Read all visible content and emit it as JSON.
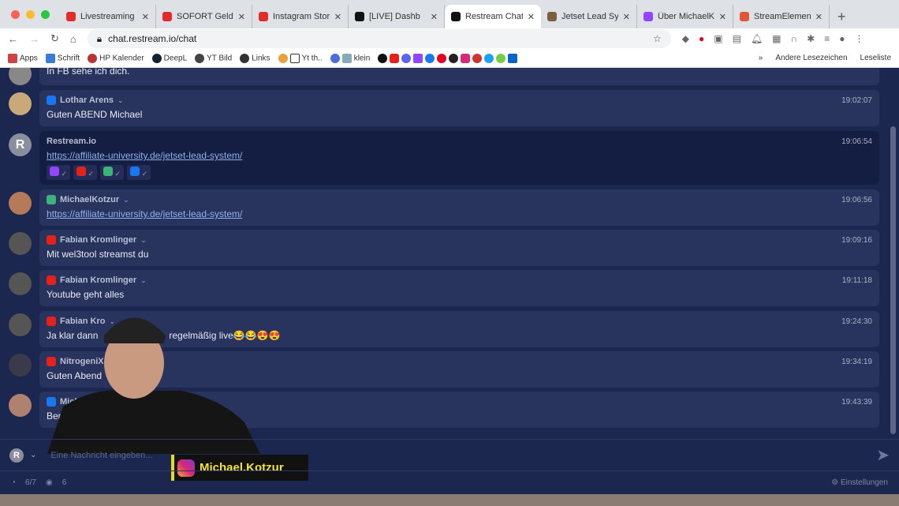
{
  "browser": {
    "tabs": [
      {
        "title": "Livestreaming",
        "color": "#e02c2c"
      },
      {
        "title": "SOFORT Geld",
        "color": "#e02c2c"
      },
      {
        "title": "Instagram Story",
        "color": "#e02c2c"
      },
      {
        "title": "[LIVE] Dashb",
        "color": "#111111"
      },
      {
        "title": "Restream Chat",
        "color": "#111111",
        "active": true
      },
      {
        "title": "Jetset Lead Sys",
        "color": "#7a6040"
      },
      {
        "title": "Über MichaelKo",
        "color": "#9146ff"
      },
      {
        "title": "StreamElement",
        "color": "#e0563a"
      }
    ],
    "url": "chat.restream.io/chat",
    "bookmarks": [
      "Apps",
      "Schrift",
      "HP Kalender",
      "DeepL",
      "YT Bild",
      "Links",
      "Yt th..",
      "klein"
    ],
    "bookmarks_right": [
      "Andere Lesezeichen",
      "Leseliste"
    ]
  },
  "messages": [
    {
      "author": "",
      "platform": "",
      "time": "",
      "text": "In FB sehe ich dich."
    },
    {
      "author": "Lothar Arens",
      "platform": "facebook",
      "time": "19:02:07",
      "text": "Guten ABEND Michael"
    },
    {
      "author": "Restream.io",
      "platform": "restream",
      "time": "19:06:54",
      "text": "https://affiliate-university.de/jetset-lead-system/"
    },
    {
      "author": "MichaelKotzur",
      "platform": "restream",
      "time": "19:06:56",
      "text": "https://affiliate-university.de/jetset-lead-system/"
    },
    {
      "author": "Fabian Kromlinger",
      "platform": "youtube",
      "time": "19:09:16",
      "text": "Mit wel3tool streamst du"
    },
    {
      "author": "Fabian Kromlinger",
      "platform": "youtube",
      "time": "19:11:18",
      "text": "Youtube geht alles"
    },
    {
      "author": "Fabian Kro",
      "platform": "youtube",
      "time": "19:24:30",
      "text": "Ja klar dann",
      "text2": "regelmäßig live😂😂😍😍"
    },
    {
      "author": "NitrogeniX",
      "platform": "youtube",
      "time": "19:34:19",
      "text": "Guten Abend"
    },
    {
      "author": "Michel Mar",
      "platform": "facebook",
      "time": "19:43:39",
      "text": "Benutz"
    }
  ],
  "colors": {
    "facebook": "#1877f2",
    "youtube": "#e62117",
    "twitch": "#9146ff",
    "restream": "#3bb37a"
  },
  "composer": {
    "placeholder": "Eine Nachricht eingeben..."
  },
  "footer": {
    "channels": "6/7",
    "viewers": "6",
    "settings": "Einstellungen"
  },
  "overlay": {
    "instagram_handle": "Michael.Kotzur"
  }
}
